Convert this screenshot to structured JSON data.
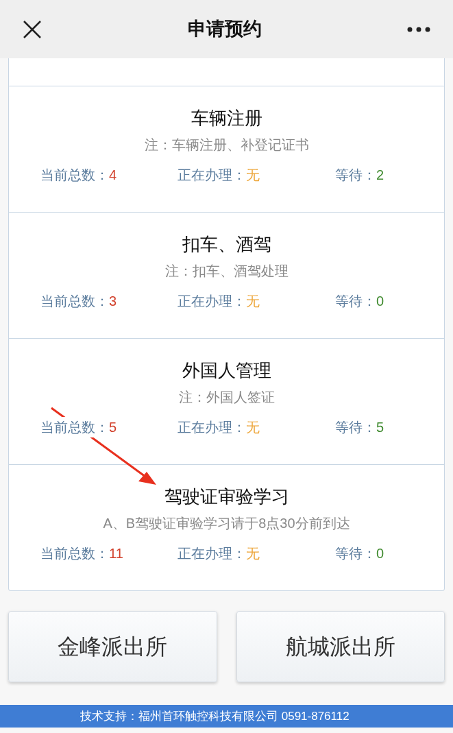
{
  "header": {
    "title": "申请预约"
  },
  "services": [
    {
      "title": "车辆注册",
      "note": "注：车辆注册、补登记证书",
      "stats": [
        {
          "kind": "total",
          "label": "当前总数：",
          "value": "4"
        },
        {
          "kind": "processing",
          "label": "正在办理：",
          "value": "无"
        },
        {
          "kind": "waiting",
          "label": "等待：",
          "value": "2"
        }
      ]
    },
    {
      "title": "扣车、酒驾",
      "note": "注：扣车、酒驾处理",
      "stats": [
        {
          "kind": "total",
          "label": "当前总数：",
          "value": "3"
        },
        {
          "kind": "processing",
          "label": "正在办理：",
          "value": "无"
        },
        {
          "kind": "waiting",
          "label": "等待：",
          "value": "0"
        }
      ]
    },
    {
      "title": "外国人管理",
      "note": "注：外国人签证",
      "stats": [
        {
          "kind": "total",
          "label": "当前总数：",
          "value": "5"
        },
        {
          "kind": "processing",
          "label": "正在办理：",
          "value": "无"
        },
        {
          "kind": "waiting",
          "label": "等待：",
          "value": "5"
        }
      ]
    },
    {
      "title": "驾驶证审验学习",
      "note": "A、B驾驶证审验学习请于8点30分前到达",
      "stats": [
        {
          "kind": "total",
          "label": "当前总数：",
          "value": "11"
        },
        {
          "kind": "processing",
          "label": "正在办理：",
          "value": "无"
        },
        {
          "kind": "waiting",
          "label": "等待：",
          "value": "0"
        }
      ]
    }
  ],
  "stations": [
    "金峰派出所",
    "航城派出所"
  ],
  "footer": "技术支持：福州首环触控科技有限公司 0591-876112"
}
